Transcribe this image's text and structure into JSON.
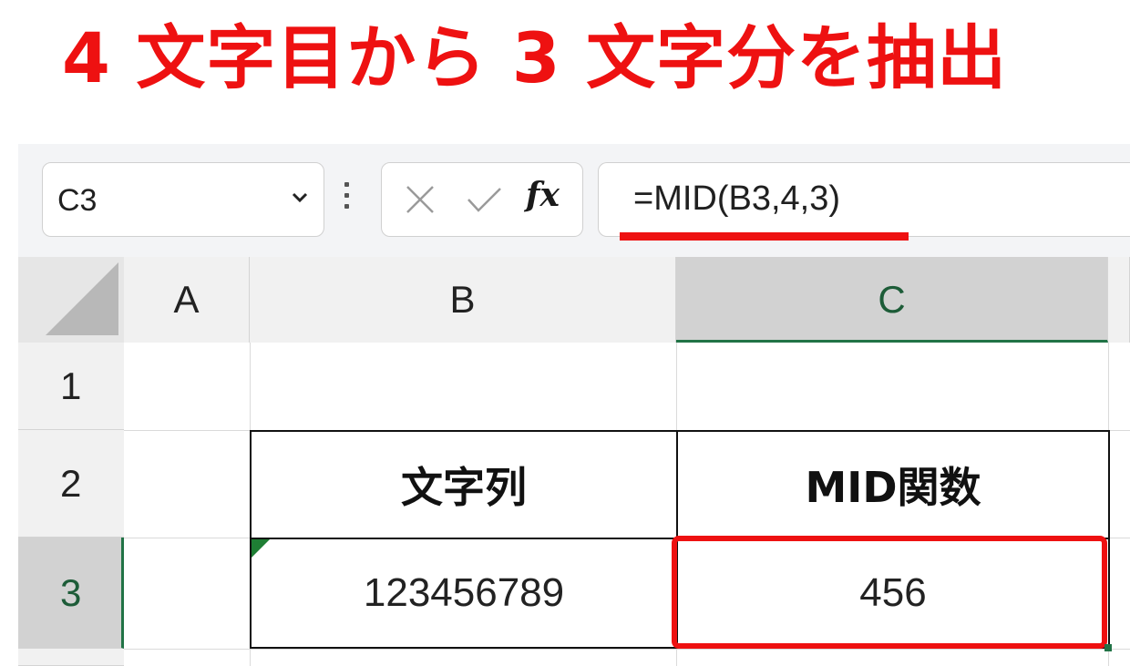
{
  "headline": "4 文字目から 3 文字分を抽出",
  "formula_bar": {
    "name_box": "C3",
    "fx_label": "fx",
    "formula": "=MID(B3,4,3)"
  },
  "sheet": {
    "columns": [
      "A",
      "B",
      "C"
    ],
    "rows": [
      "1",
      "2",
      "3"
    ],
    "selected_cell": "C3",
    "cells": {
      "B2": "文字列",
      "C2": "MID関数",
      "B3": "123456789",
      "C3": "456"
    }
  },
  "colors": {
    "accent_red": "#ee1111",
    "excel_green": "#217346"
  }
}
